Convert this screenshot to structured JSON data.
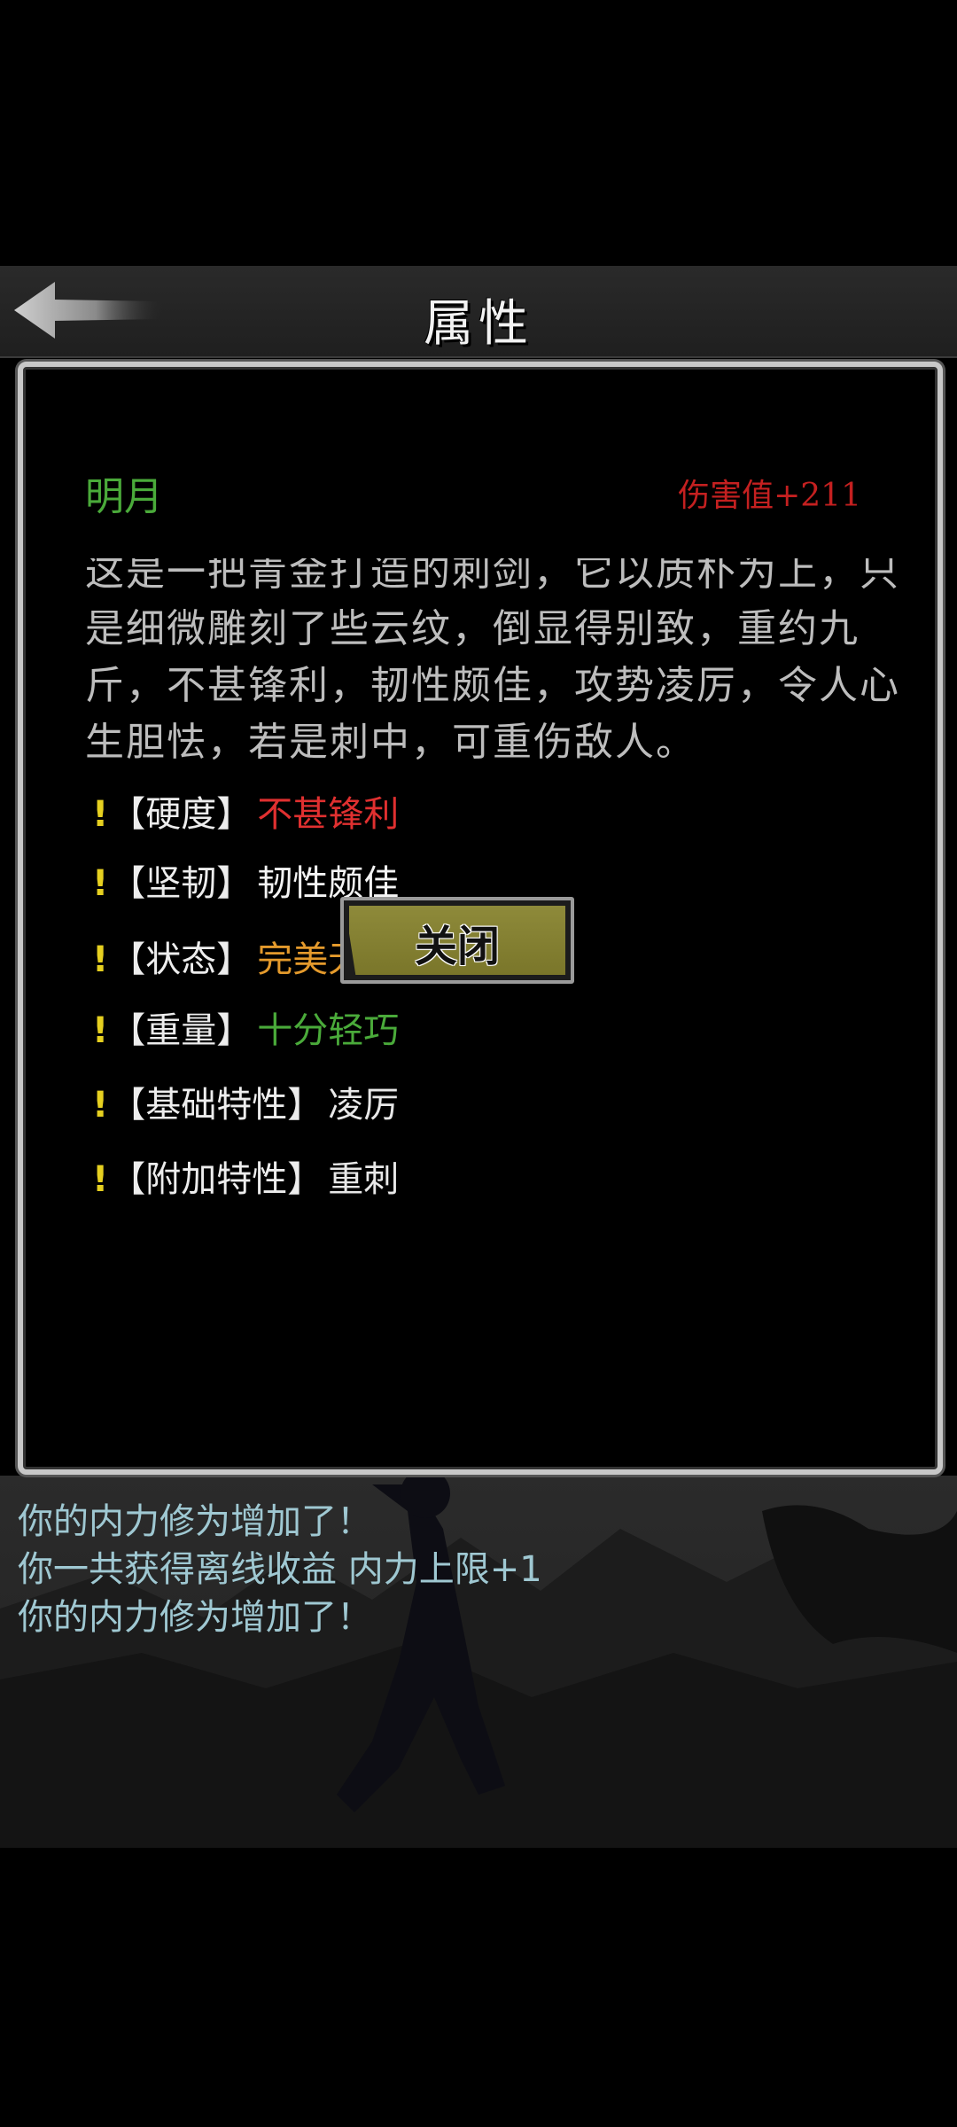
{
  "header": {
    "title": "属性",
    "back_icon": "back-arrow-icon"
  },
  "item": {
    "name": "明月",
    "damage": "伤害值+211",
    "description": "这是一把青金打造的刺剑，它以质朴为上，只是细微雕刻了些云纹，倒显得别致，重约九斤，不甚锋利，韧性颇佳，攻势凌厉，令人心生胆怯，若是刺中，可重伤敌人。",
    "attributes": [
      {
        "marker": "!",
        "label": "【硬度】",
        "value": "不甚锋利",
        "color": "#e03030"
      },
      {
        "marker": "!",
        "label": "【坚韧】",
        "value": "韧性颇佳",
        "color": "#f4f4f4"
      },
      {
        "marker": "!",
        "label": "【状态】",
        "value": "完美无缺",
        "color": "#e49a2c"
      },
      {
        "marker": "!",
        "label": "【重量】",
        "value": "十分轻巧",
        "color": "#4aaa3a"
      },
      {
        "marker": "!",
        "label": "【基础特性】",
        "value": "凌厉",
        "color": "#e8e8e8"
      },
      {
        "marker": "!",
        "label": "【附加特性】",
        "value": "重刺",
        "color": "#e8e8e8"
      }
    ]
  },
  "actions": {
    "close_label": "关闭"
  },
  "log": {
    "lines": [
      "你的内力修为增加了！",
      "你一共获得离线收益 内力上限+1",
      "你的内力修为增加了！"
    ]
  },
  "colors": {
    "name_green": "#4aaa3a",
    "damage_red": "#c42020",
    "marker_yellow": "#e6d020",
    "log_text": "#9fc8d2",
    "button_olive": "#8e8a3a"
  }
}
